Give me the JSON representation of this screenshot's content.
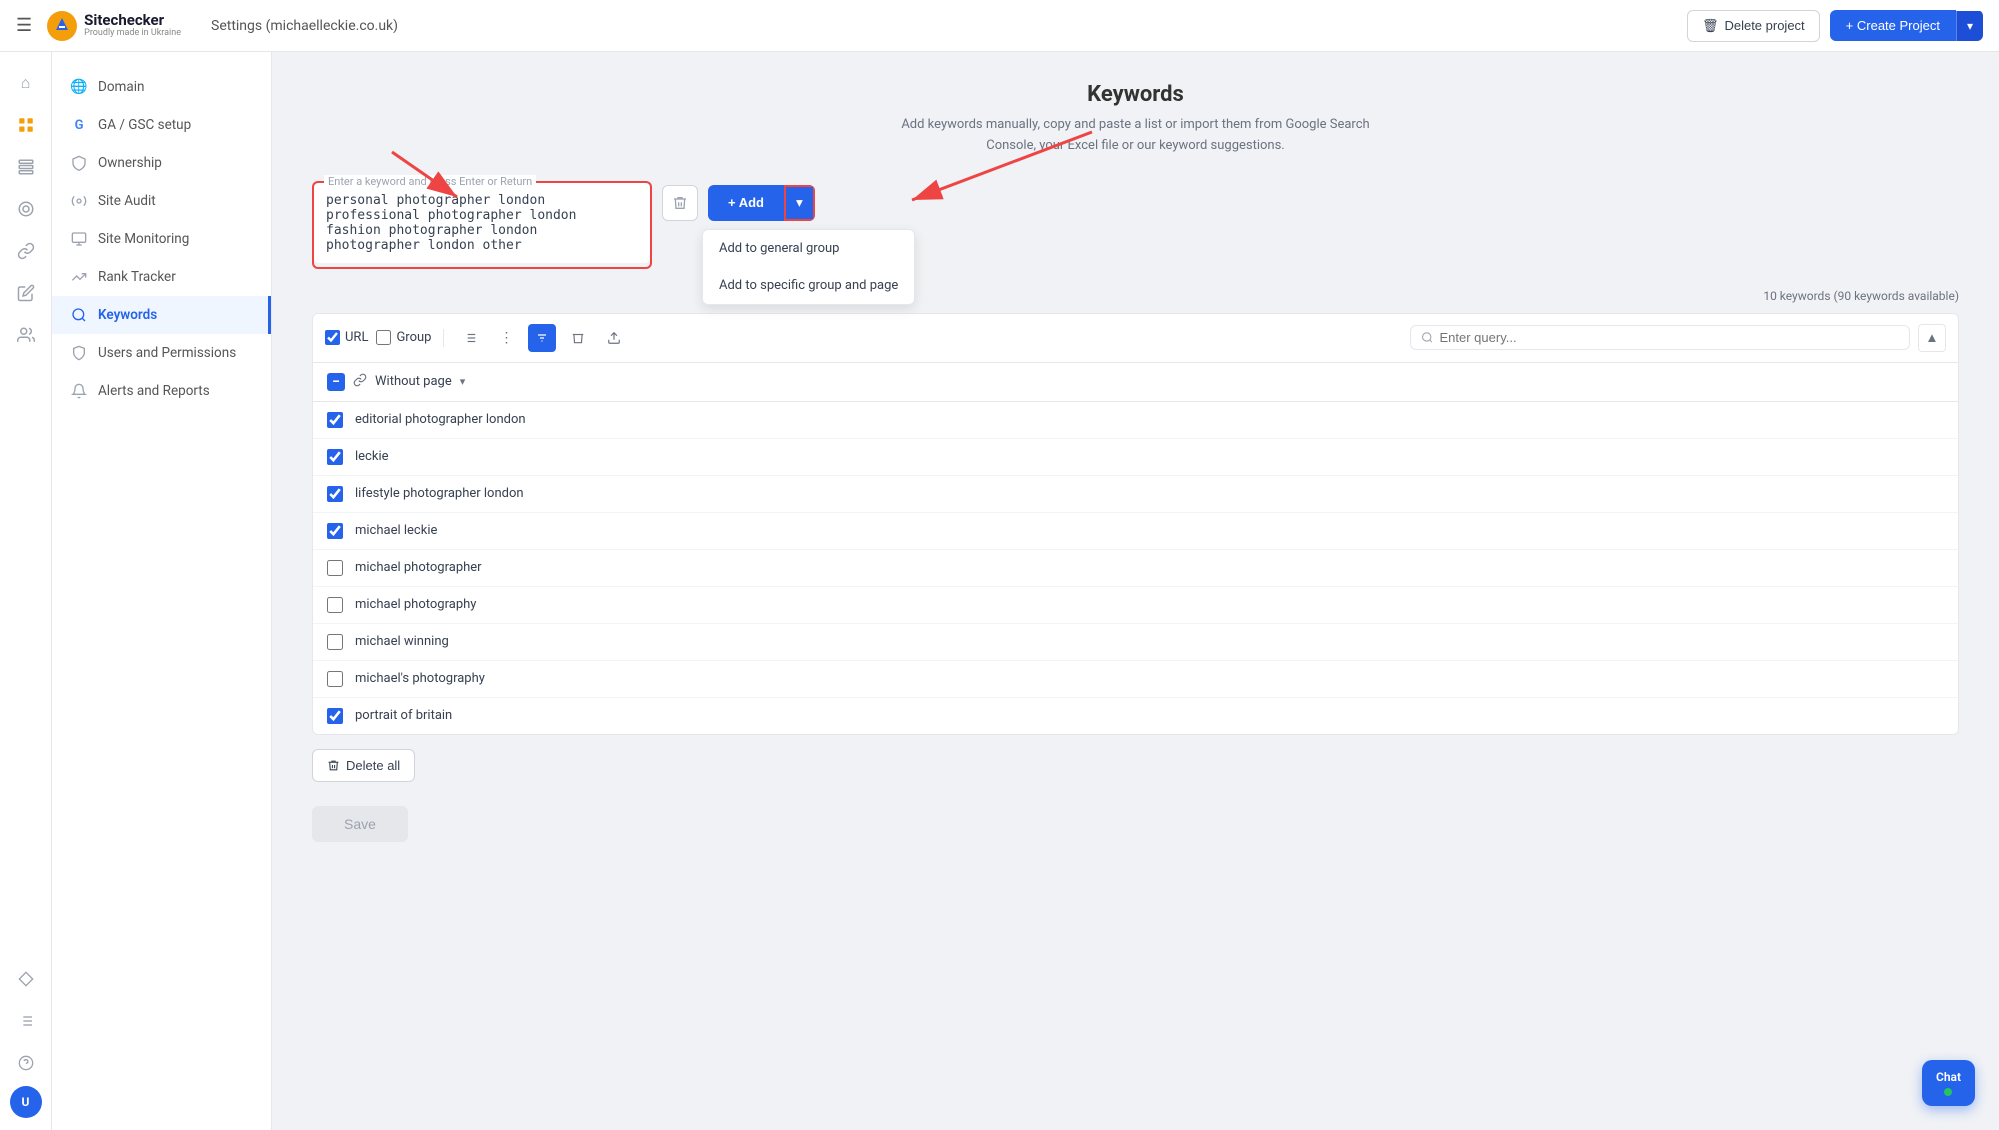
{
  "app": {
    "name": "Sitechecker",
    "tagline": "Proudly made in Ukraine",
    "settings_title": "Settings (michaelleckie.co.uk)"
  },
  "topnav": {
    "delete_project_label": "Delete project",
    "create_project_label": "+ Create Project"
  },
  "icon_sidebar": {
    "items": [
      {
        "name": "home-icon",
        "icon": "⌂",
        "active": false
      },
      {
        "name": "star-icon",
        "icon": "★",
        "active": true
      },
      {
        "name": "grid-icon",
        "icon": "▦",
        "active": false
      },
      {
        "name": "analytics-icon",
        "icon": "◎",
        "active": false
      },
      {
        "name": "link-icon",
        "icon": "🔗",
        "active": false
      },
      {
        "name": "edit-icon",
        "icon": "✎",
        "active": false
      },
      {
        "name": "team-icon",
        "icon": "👥",
        "active": false
      }
    ],
    "bottom": [
      {
        "name": "diamond-icon",
        "icon": "◇"
      },
      {
        "name": "list-icon",
        "icon": "≡"
      },
      {
        "name": "help-icon",
        "icon": "?"
      }
    ],
    "avatar_label": "U"
  },
  "settings_nav": {
    "items": [
      {
        "id": "domain",
        "label": "Domain",
        "icon": "🌐",
        "active": false
      },
      {
        "id": "ga-gsc",
        "label": "GA / GSC setup",
        "icon": "G",
        "active": false
      },
      {
        "id": "ownership",
        "label": "Ownership",
        "icon": "👑",
        "active": false
      },
      {
        "id": "site-audit",
        "label": "Site Audit",
        "icon": "⚙",
        "active": false
      },
      {
        "id": "site-monitoring",
        "label": "Site Monitoring",
        "icon": "📊",
        "active": false
      },
      {
        "id": "rank-tracker",
        "label": "Rank Tracker",
        "icon": "📈",
        "active": false
      },
      {
        "id": "keywords",
        "label": "Keywords",
        "icon": "🔑",
        "active": true
      },
      {
        "id": "users-permissions",
        "label": "Users and Permissions",
        "icon": "🛡",
        "active": false
      },
      {
        "id": "alerts-reports",
        "label": "Alerts and Reports",
        "icon": "🔔",
        "active": false
      }
    ]
  },
  "main": {
    "page_title": "Keywords",
    "page_subtitle": "Add keywords manually, copy and paste a list or import them from Google Search Console, your Excel file or our keyword suggestions.",
    "add_placeholder": "Enter a keyword and press Enter or Return",
    "textarea_value": "personal photographer london\nprofessional photographer london\nfashion photographer london\nphotographer london other",
    "add_button_label": "+ Add",
    "dropdown_items": [
      {
        "label": "Add to general group"
      },
      {
        "label": "Add to specific group and page"
      }
    ],
    "keywords_count": "10 keywords (90 keywords available)",
    "toolbar": {
      "url_label": "URL",
      "group_label": "Group",
      "search_placeholder": "Enter query..."
    },
    "without_page_label": "Without page",
    "keywords": [
      {
        "id": 1,
        "text": "editorial photographer london",
        "checked": true
      },
      {
        "id": 2,
        "text": "leckie",
        "checked": true
      },
      {
        "id": 3,
        "text": "lifestyle photographer london",
        "checked": true
      },
      {
        "id": 4,
        "text": "michael leckie",
        "checked": true
      },
      {
        "id": 5,
        "text": "michael photographer",
        "checked": false
      },
      {
        "id": 6,
        "text": "michael photography",
        "checked": false
      },
      {
        "id": 7,
        "text": "michael winning",
        "checked": false
      },
      {
        "id": 8,
        "text": "michael's photography",
        "checked": false
      },
      {
        "id": 9,
        "text": "portrait of britain",
        "checked": true
      }
    ],
    "delete_all_label": "Delete all",
    "save_label": "Save"
  },
  "chat": {
    "label": "Chat"
  }
}
